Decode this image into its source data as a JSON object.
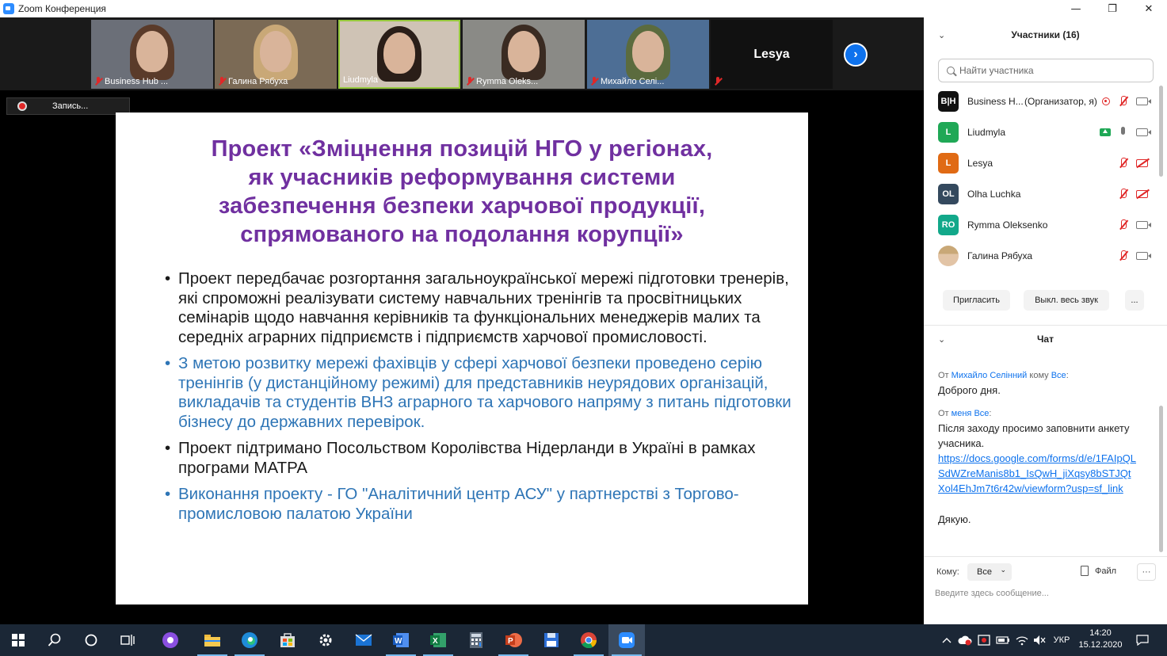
{
  "window": {
    "title": "Zoom Конференция",
    "controls": {
      "minimize": "—",
      "restore": "❐",
      "close": "✕"
    }
  },
  "thumbnails": [
    {
      "name": "Business Hub ...",
      "muted": true,
      "hair": "#5a3b2a",
      "bg": "#6b6f78"
    },
    {
      "name": "Галина Рябуха",
      "muted": true,
      "hair": "#c9a877",
      "bg": "#7b6a55"
    },
    {
      "name": "Liudmyla",
      "muted": false,
      "active": true,
      "hair": "#2a1e18",
      "bg": "#cfc3b5"
    },
    {
      "name": "Rymma Oleks...",
      "muted": true,
      "hair": "#3a2b22",
      "bg": "#8a8a86"
    },
    {
      "name": "Михайло Селі...",
      "muted": true,
      "hair": "#5b6b3e",
      "bg": "#4d6e95"
    },
    {
      "name": "Lesya",
      "muted": true,
      "name_only": true
    }
  ],
  "recording": {
    "label": "Запись..."
  },
  "slide": {
    "title_lines": [
      "Проект «Зміцнення позицій НГО у регіонах,",
      "як учасників реформування системи",
      "забезпечення безпеки харчової продукції,",
      "спрямованого на подолання корупції»"
    ],
    "bullets": [
      {
        "style": "dark",
        "text": "Проект передбачає розгортання загальноукраїнської мережі підготовки тренерів, які спроможні реалізувати систему навчальних тренінгів та просвітницьких семінарів щодо навчання керівників та функціональних менеджерів малих та середніх аграрних підприємств і підприємств харчової промисловості."
      },
      {
        "style": "blue",
        "text": "З метою розвитку мережі фахівців у сфері харчової безпеки проведено серію тренінгів (у дистанційному режимі) для представників неурядових організацій, викладачів та студентів ВНЗ аграрного та харчового напряму з питань підготовки бізнесу до державних перевірок."
      },
      {
        "style": "dark",
        "text": "Проект підтримано Посольством Королівства Нідерланди в Україні в рамках програми МАТРА"
      },
      {
        "style": "blue",
        "text": "Виконання проекту -  ГО \"Аналітичний центр АСУ\" у партнерстві з Торгово-промисловою палатою України"
      }
    ]
  },
  "participants": {
    "header": "Участники (16)",
    "search_placeholder": "Найти участника",
    "list": [
      {
        "initials": "B|H",
        "color": "#111111",
        "name": "Business H...",
        "role": "(Организатор, я)",
        "recording": true,
        "mic": "off",
        "cam": "on"
      },
      {
        "initials": "L",
        "color": "#1fa856",
        "name": "Liudmyla",
        "role": "",
        "sharing": true,
        "mic": "on",
        "cam": "on"
      },
      {
        "initials": "L",
        "color": "#e06a14",
        "name": "Lesya",
        "role": "",
        "mic": "off",
        "cam": "off"
      },
      {
        "initials": "OL",
        "color": "#34495e",
        "name": "Olha Luchka",
        "role": "",
        "mic": "off",
        "cam": "off"
      },
      {
        "initials": "RO",
        "color": "#12a88a",
        "name": "Rymma Oleksenko",
        "role": "",
        "mic": "off",
        "cam": "on"
      },
      {
        "initials": "",
        "color": "#d8b79a",
        "name": "Галина Рябуха",
        "role": "",
        "photo": true,
        "mic": "off",
        "cam": "on"
      }
    ],
    "buttons": {
      "invite": "Пригласить",
      "mute_all": "Выкл. весь звук",
      "more": "..."
    }
  },
  "chat": {
    "header": "Чат",
    "messages": [
      {
        "from_prefix": "От",
        "from": "Михайло Селінний",
        "to_prefix": "кому",
        "to": "Все",
        "text": "Доброго дня."
      },
      {
        "from_prefix": "От",
        "from": "меня",
        "to_prefix": "",
        "to": "Все",
        "text": "Після заходу просимо заповнити анкету учасника.",
        "link": "https://docs.google.com/forms/d/e/1FAIpQLSdWZreManis8b1_IsQwH_jiXqsy8bSTJQtXol4EhJm7t6r42w/viewform?usp=sf_link",
        "after": "Дякую."
      }
    ],
    "to_label": "Кому:",
    "to_value": "Все",
    "file_label": "Файл",
    "more": "···",
    "input_placeholder": "Введите здесь сообщение..."
  },
  "taskbar": {
    "language": "УКР",
    "time": "14:20",
    "date": "15.12.2020"
  }
}
